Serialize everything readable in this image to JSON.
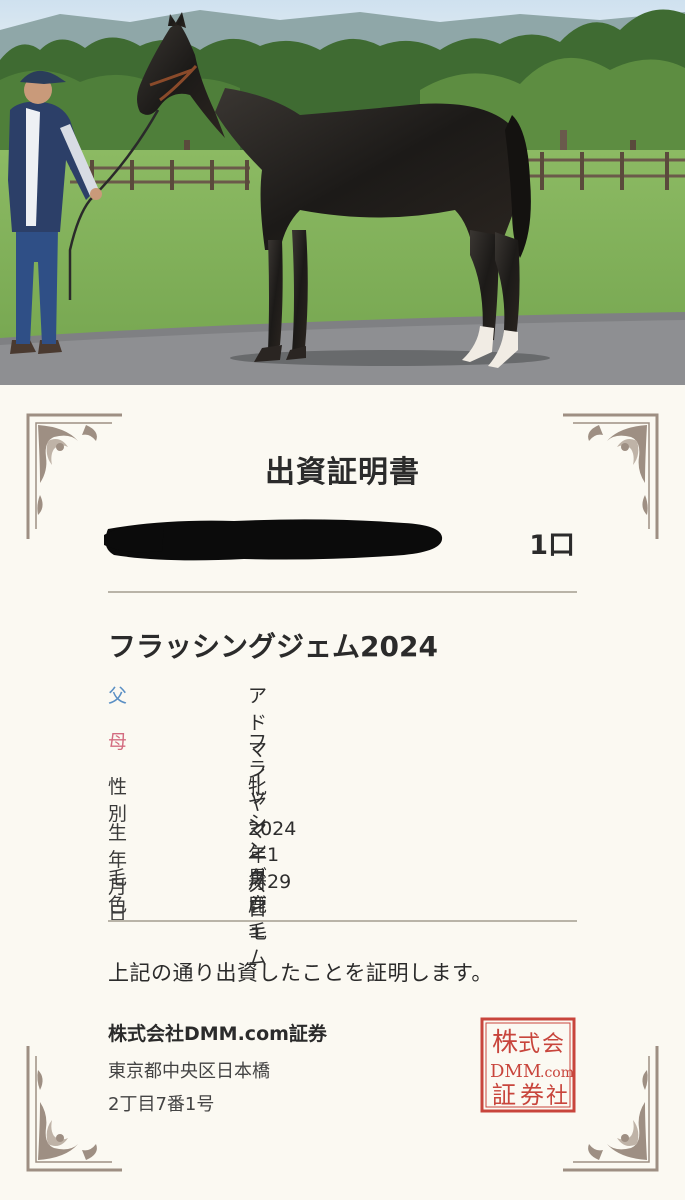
{
  "certificate": {
    "title": "出資証明書",
    "units": "1口",
    "horse_name": "フラッシングジェム2024",
    "details": [
      {
        "label": "父",
        "value": "アドマイヤマーズ"
      },
      {
        "label": "母",
        "value": "フラッシングジェム"
      },
      {
        "label": "性別",
        "value": "牝"
      },
      {
        "label": "生年月日",
        "value": "2024年1月29日"
      },
      {
        "label": "毛色",
        "value": "黒鹿毛"
      }
    ],
    "statement": "上記の通り出資したことを証明します。",
    "company": "株式会社DMM.com証券",
    "address_line1": "東京都中央区日本橋",
    "address_line2": "2丁目7番1号",
    "seal_text": "株式会社 DMM.com 証券"
  },
  "colors": {
    "sire_label": "#5a8fc4",
    "dam_label": "#d36c80",
    "seal_red": "#c8453c",
    "ornament": "#9e8f83"
  }
}
